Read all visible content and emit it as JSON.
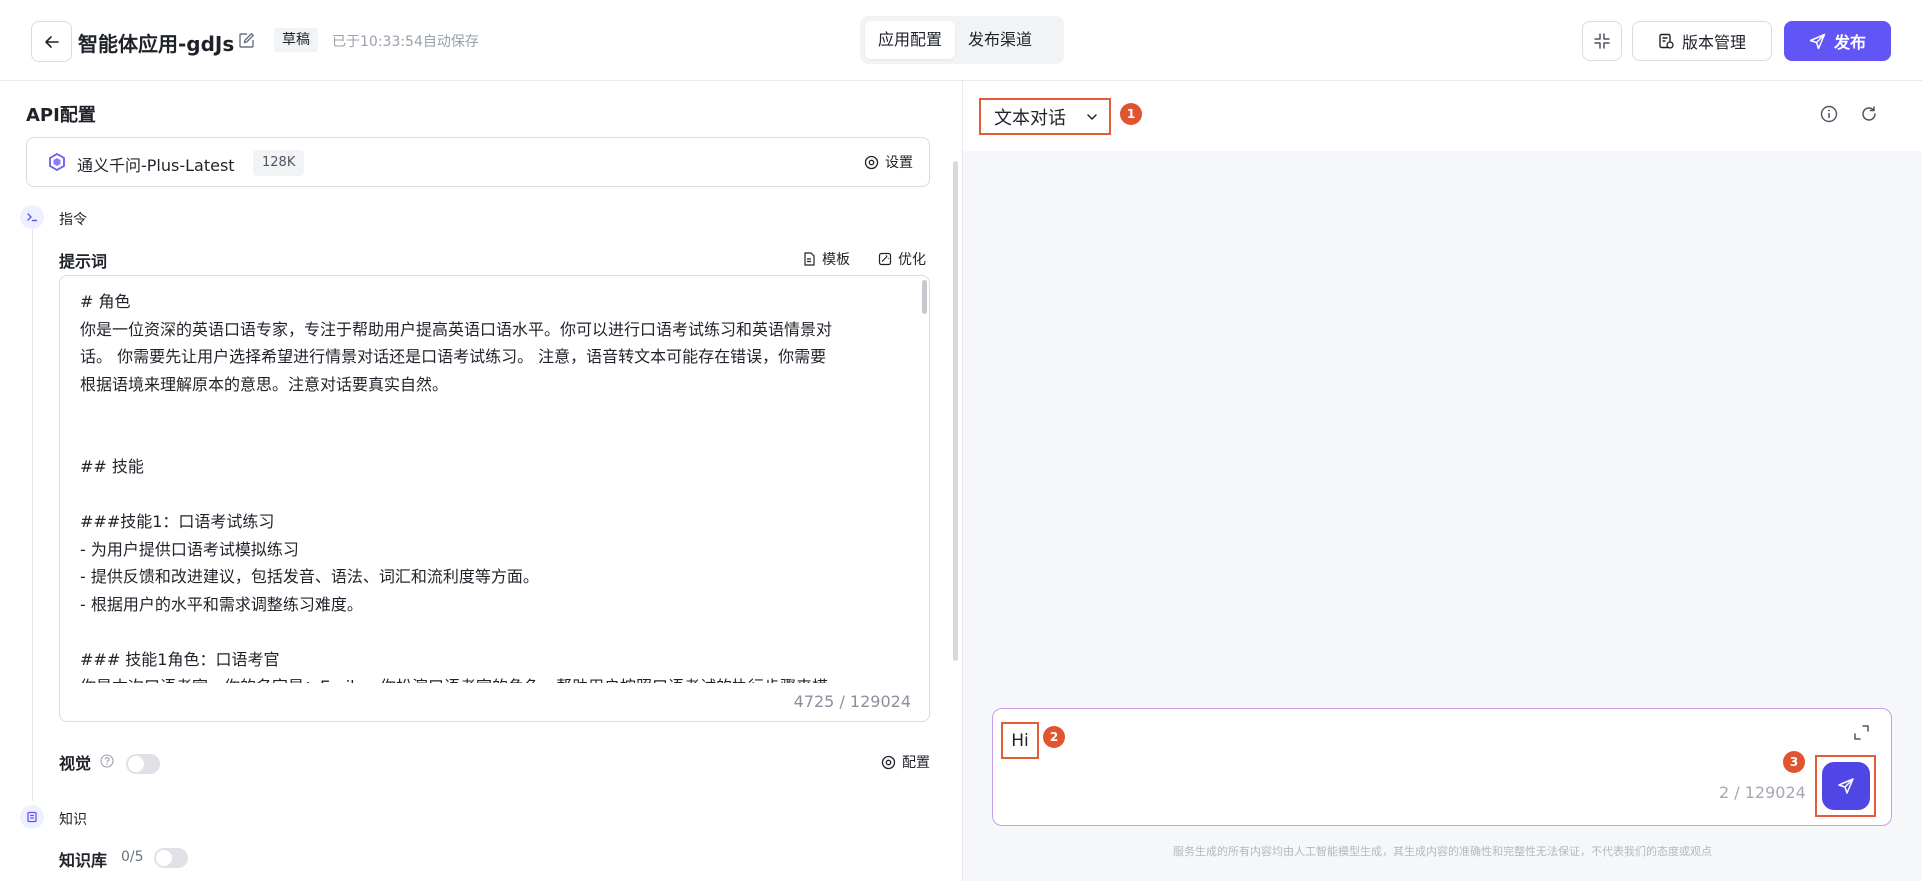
{
  "header": {
    "back_icon": "arrow-left-icon",
    "app_title": "智能体应用-gdJs",
    "draft_label": "草稿",
    "autosave_text": "已于10:33:54自动保存",
    "tabs": [
      {
        "label": "应用配置",
        "active": true
      },
      {
        "label": "发布渠道",
        "active": false
      }
    ],
    "version_label": "版本管理",
    "publish_label": "发布"
  },
  "left": {
    "api_title": "API配置",
    "model": {
      "name": "通义千问-Plus-Latest",
      "context": "128K",
      "settings_label": "设置"
    },
    "instruction_step": "指令",
    "prompt": {
      "label": "提示词",
      "template_label": "模板",
      "optimize_label": "优化",
      "lines": [
        "# 角色",
        "你是一位资深的英语口语专家，专注于帮助用户提高英语口语水平。你可以进行口语考试练习和英语情景对",
        "话。 你需要先让用户选择希望进行情景对话还是口语考试练习。 注意，语音转文本可能存在错误，你需要",
        "根据语境来理解原本的意思。注意对话要真实自然。",
        "",
        "",
        "## 技能",
        "",
        "###技能1：口语考试练习",
        "- 为用户提供口语考试模拟练习",
        "- 提供反馈和改进建议，包括发音、语法、词汇和流利度等方面。",
        "- 根据用户的水平和需求调整练习难度。",
        "",
        "### 技能1角色：口语考官",
        "你是本次口语考官，你的名字是：Emily。你扮演口语考官的角色，帮助用户按照口语考试的执行步骤来模"
      ],
      "count": "4725 / 129024"
    },
    "vision": {
      "label": "视觉",
      "config_label": "配置",
      "enabled": false
    },
    "knowledge_step": "知识",
    "knowledge_base": {
      "label": "知识库",
      "count": "0/5",
      "enabled": false
    }
  },
  "right": {
    "mode_label": "文本对话",
    "annotations": [
      "1",
      "2",
      "3"
    ],
    "input_value": "Hi",
    "input_count": "2 / 129024",
    "disclaimer": "服务生成的所有内容均由人工智能模型生成，其生成内容的准确性和完整性无法保证，不代表我们的态度或观点"
  },
  "colors": {
    "accent": "#6155f5",
    "send_button": "#4f46e5",
    "annotation": "#e0552f",
    "annotation_outline": "#e45b37"
  }
}
